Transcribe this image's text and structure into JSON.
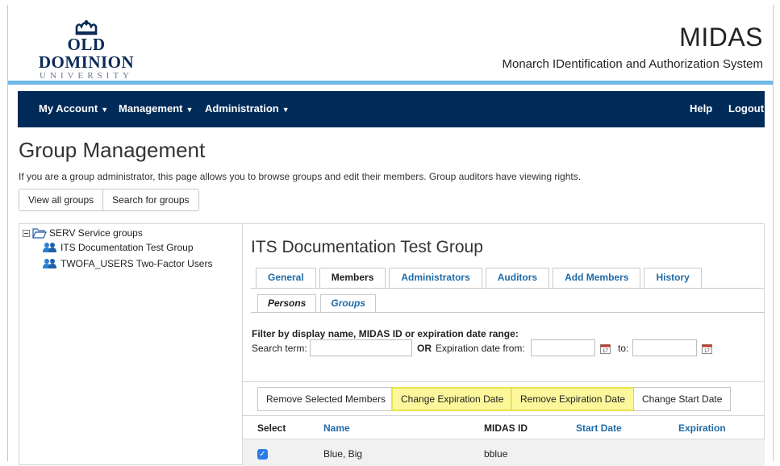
{
  "header": {
    "logo_main": "OLD DOMINION",
    "logo_sub": "UNIVERSITY",
    "app_title": "MIDAS",
    "app_subtitle": "Monarch IDentification and Authorization System"
  },
  "nav": {
    "left": [
      {
        "label": "My Account"
      },
      {
        "label": "Management"
      },
      {
        "label": "Administration"
      }
    ],
    "right": [
      {
        "label": "Help"
      },
      {
        "label": "Logout"
      }
    ]
  },
  "page": {
    "title": "Group Management",
    "description": "If you are a group administrator, this page allows you to browse groups and edit their members. Group auditors have viewing rights.",
    "buttons": {
      "view_all": "View all groups",
      "search": "Search for groups"
    }
  },
  "tree": {
    "root": "SERV Service groups",
    "children": [
      {
        "label": "ITS Documentation Test Group"
      },
      {
        "label": "TWOFA_USERS Two-Factor Users"
      }
    ]
  },
  "detail": {
    "title": "ITS Documentation Test Group",
    "tabs": [
      {
        "label": "General",
        "active": false
      },
      {
        "label": "Members",
        "active": true
      },
      {
        "label": "Administrators",
        "active": false
      },
      {
        "label": "Auditors",
        "active": false
      },
      {
        "label": "Add Members",
        "active": false
      },
      {
        "label": "History",
        "active": false
      }
    ],
    "subtabs": [
      {
        "label": "Persons",
        "active": true
      },
      {
        "label": "Groups",
        "active": false
      }
    ],
    "filter": {
      "heading": "Filter by display name, MIDAS ID or expiration date range:",
      "search_label": "Search term:",
      "search_value": "",
      "or_label": "OR",
      "from_label": "Expiration date from:",
      "from_value": "",
      "to_label": "to:",
      "to_value": ""
    },
    "actions": {
      "remove_selected": "Remove Selected Members",
      "change_expiration": "Change Expiration Date",
      "remove_expiration": "Remove Expiration Date",
      "change_start": "Change Start Date"
    },
    "table": {
      "headers": {
        "select": "Select",
        "name": "Name",
        "midas_id": "MIDAS ID",
        "start_date": "Start Date",
        "expiration": "Expiration"
      },
      "rows": [
        {
          "selected": true,
          "name": "Blue, Big",
          "midas_id": "bblue",
          "start_date": "",
          "expiration": ""
        }
      ]
    },
    "highlight_color": "#fcf79b"
  }
}
